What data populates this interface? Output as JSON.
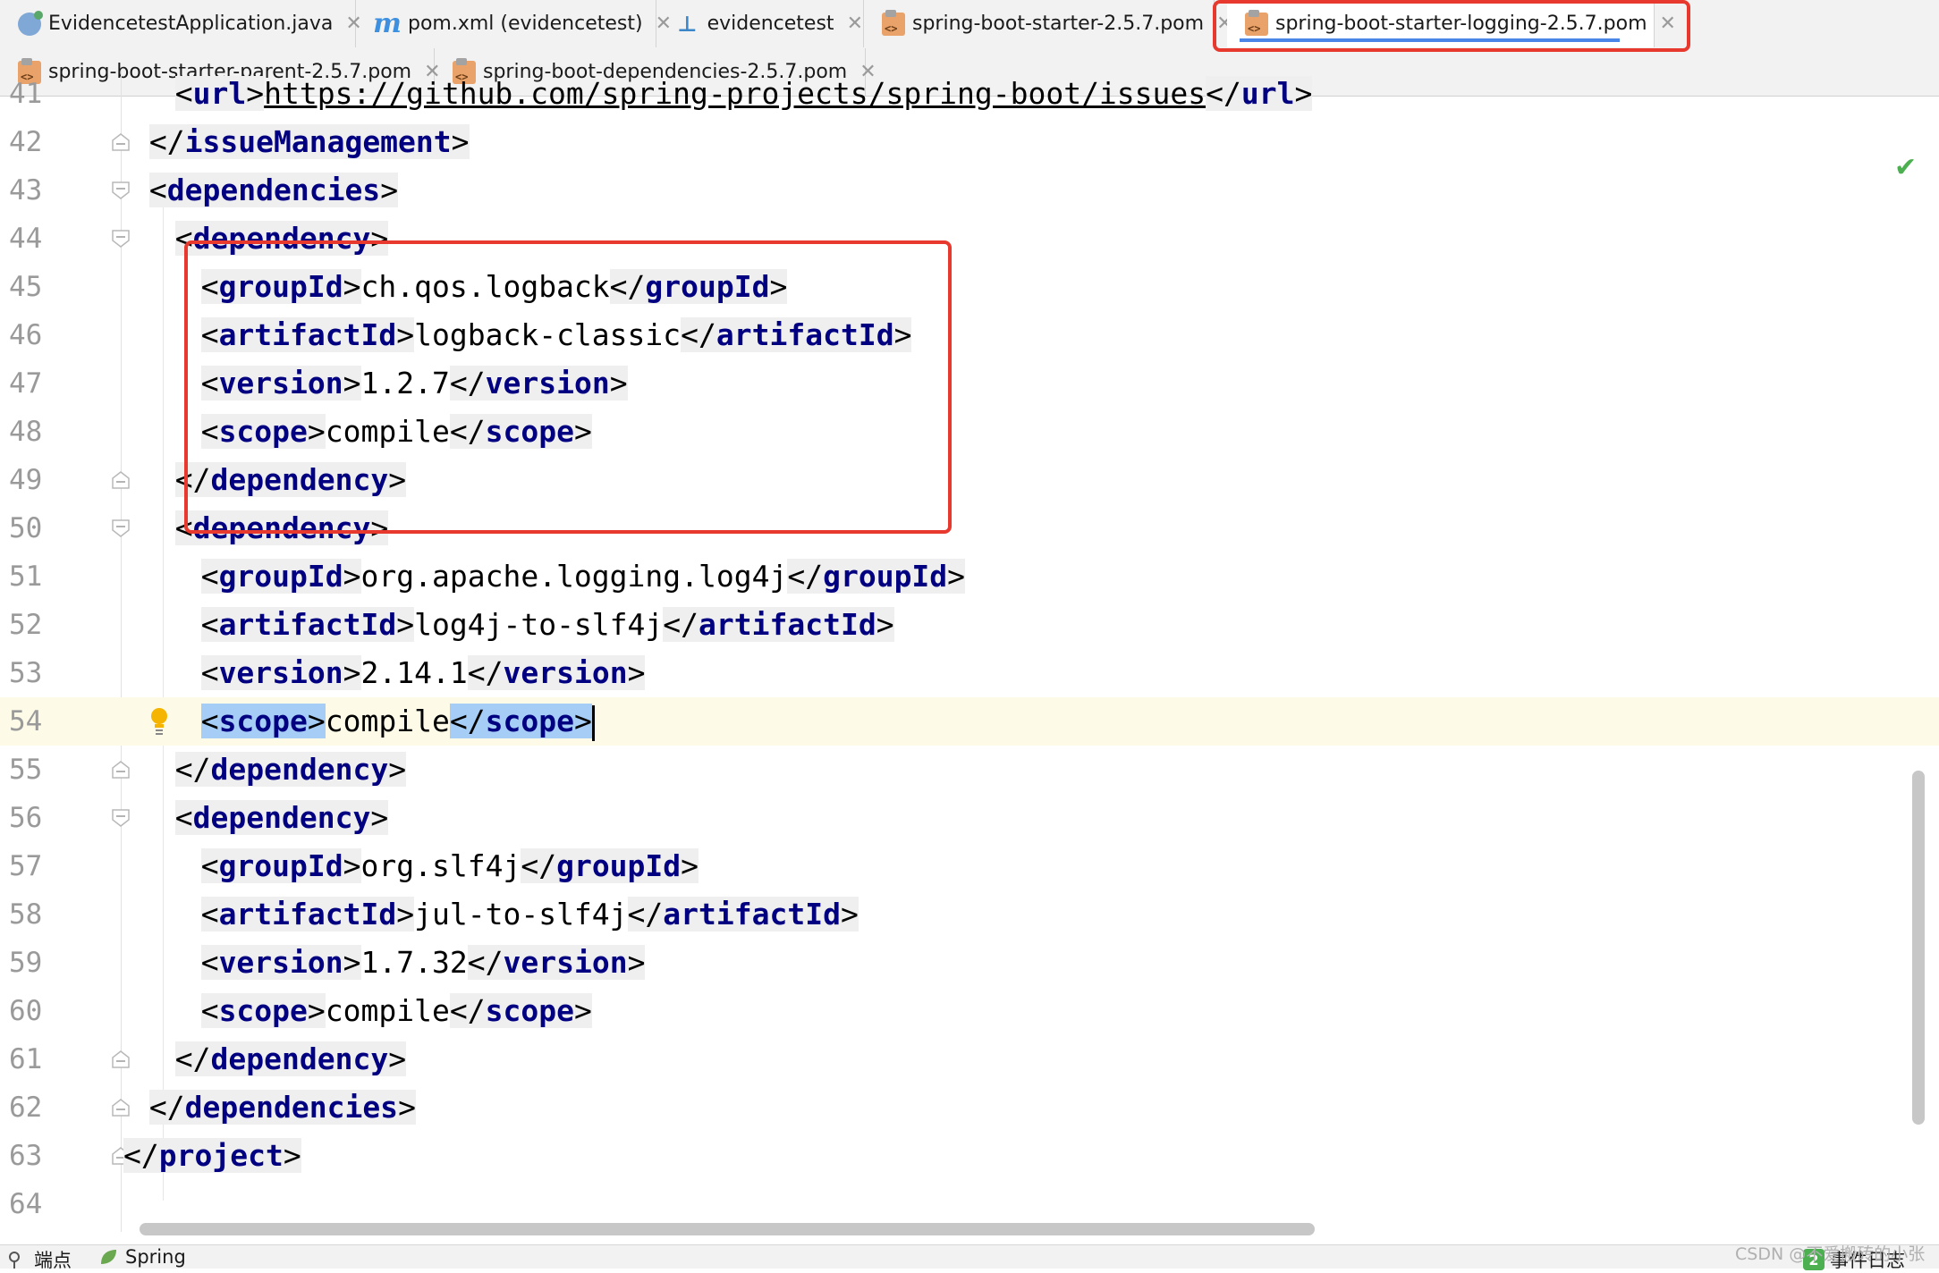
{
  "tabs_row1": [
    {
      "label": "EvidencetestApplication.java",
      "icon": "java-class-icon"
    },
    {
      "label": "pom.xml (evidencetest)",
      "icon": "maven-icon"
    },
    {
      "label": "evidencetest",
      "icon": "module-tree-icon"
    },
    {
      "label": "spring-boot-starter-2.5.7.pom",
      "icon": "pom-file-icon"
    },
    {
      "label": "spring-boot-starter-logging-2.5.7.pom",
      "icon": "pom-file-icon",
      "active": true
    }
  ],
  "tabs_row2": [
    {
      "label": "spring-boot-starter-parent-2.5.7.pom",
      "icon": "pom-file-icon"
    },
    {
      "label": "spring-boot-dependencies-2.5.7.pom",
      "icon": "pom-file-icon"
    }
  ],
  "editor": {
    "lines": [
      {
        "n": "41",
        "url": "https://github.com/spring-projects/spring-boot/issues"
      },
      {
        "n": "42",
        "close": "issueManagement"
      },
      {
        "n": "43",
        "open": "dependencies"
      },
      {
        "n": "44",
        "open": "dependency"
      },
      {
        "n": "45",
        "tag": "groupId",
        "value": "ch.qos.logback"
      },
      {
        "n": "46",
        "tag": "artifactId",
        "value": "logback-classic"
      },
      {
        "n": "47",
        "tag": "version",
        "value": "1.2.7"
      },
      {
        "n": "48",
        "tag": "scope",
        "value": "compile"
      },
      {
        "n": "49",
        "close": "dependency"
      },
      {
        "n": "50",
        "open": "dependency"
      },
      {
        "n": "51",
        "tag": "groupId",
        "value": "org.apache.logging.log4j"
      },
      {
        "n": "52",
        "tag": "artifactId",
        "value": "log4j-to-slf4j"
      },
      {
        "n": "53",
        "tag": "version",
        "value": "2.14.1"
      },
      {
        "n": "54",
        "tag": "scope",
        "value": "compile"
      },
      {
        "n": "55",
        "close": "dependency"
      },
      {
        "n": "56",
        "open": "dependency"
      },
      {
        "n": "57",
        "tag": "groupId",
        "value": "org.slf4j"
      },
      {
        "n": "58",
        "tag": "artifactId",
        "value": "jul-to-slf4j"
      },
      {
        "n": "59",
        "tag": "version",
        "value": "1.7.32"
      },
      {
        "n": "60",
        "tag": "scope",
        "value": "compile"
      },
      {
        "n": "61",
        "close": "dependency"
      },
      {
        "n": "62",
        "close": "dependencies"
      },
      {
        "n": "63",
        "close": "project"
      },
      {
        "n": "64"
      }
    ]
  },
  "status": {
    "breakpoints_label": "端点",
    "spring_label": "Spring",
    "event_log_label": "事件日志",
    "event_count": "2",
    "watermark": "CSDN @不爱搬砖的小张"
  },
  "colors": {
    "tag": "#000080",
    "highlight_box": "#e8392e",
    "selection": "#a6cdf5",
    "current_line": "#fdfbe8"
  }
}
